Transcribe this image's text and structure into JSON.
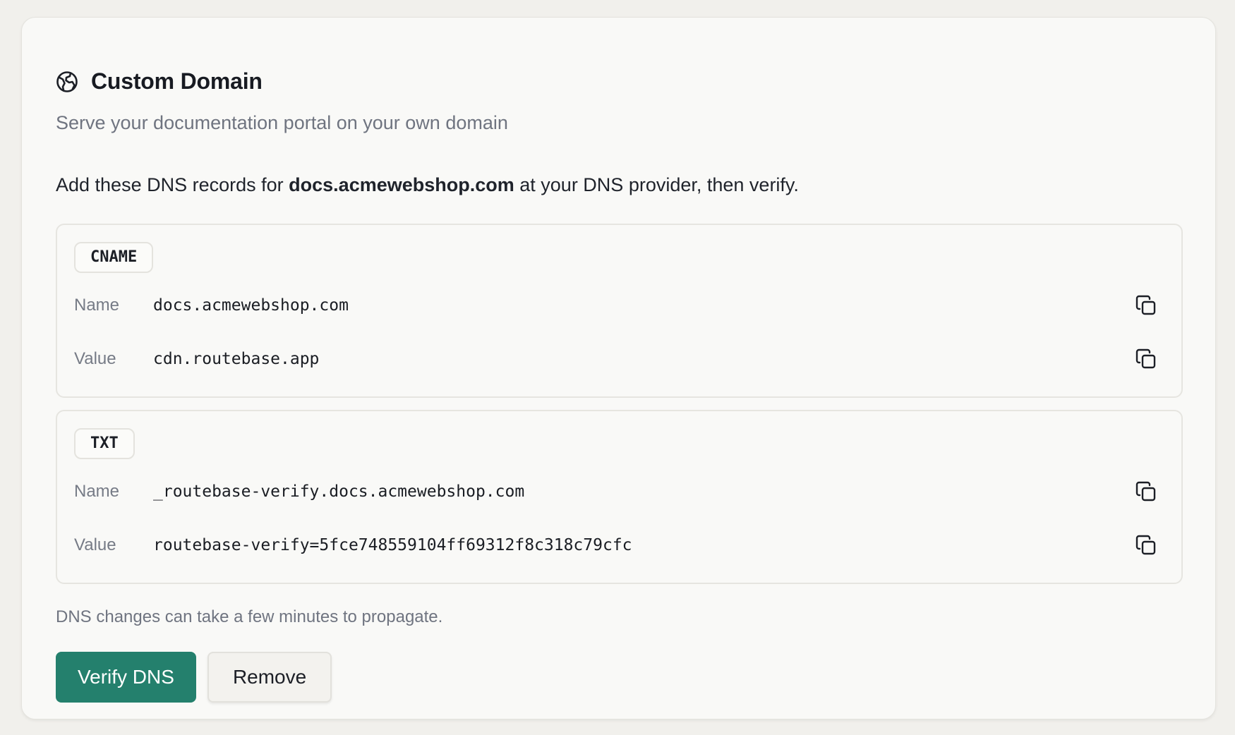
{
  "card": {
    "title": "Custom Domain",
    "subtitle": "Serve your documentation portal on your own domain",
    "instructions": {
      "prefix": "Add these DNS records for ",
      "domain": "docs.acmewebshop.com",
      "suffix": " at your DNS provider, then verify."
    },
    "icon": "globe-icon"
  },
  "records": [
    {
      "type": "CNAME",
      "name_label": "Name",
      "name_value": "docs.acmewebshop.com",
      "value_label": "Value",
      "value_value": "cdn.routebase.app"
    },
    {
      "type": "TXT",
      "name_label": "Name",
      "name_value": "_routebase-verify.docs.acmewebshop.com",
      "value_label": "Value",
      "value_value": "routebase-verify=5fce748559104ff69312f8c318c79cfc"
    }
  ],
  "note": "DNS changes can take a few minutes to propagate.",
  "actions": {
    "verify_label": "Verify DNS",
    "remove_label": "Remove"
  },
  "colors": {
    "accent": "#24806d",
    "background": "#f1f0ec",
    "card": "#f9f9f7",
    "muted_text": "#6f7480"
  }
}
